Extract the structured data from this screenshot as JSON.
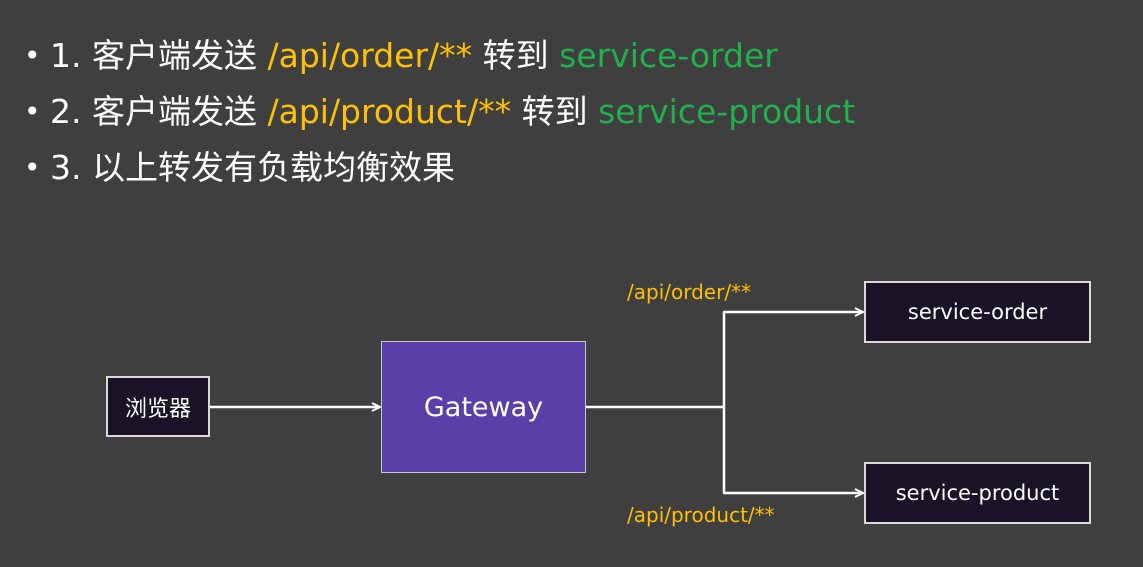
{
  "bullets": [
    {
      "num": "1. ",
      "text1": "客户端发送 ",
      "path": "/api/order/**",
      "text2": " 转到 ",
      "service": "service-order"
    },
    {
      "num": "2. ",
      "text1": "客户端发送 ",
      "path": "/api/product/**",
      "text2": " 转到 ",
      "service": "service-product"
    },
    {
      "num": "3. ",
      "text1": "以上转发有负载均衡效果"
    }
  ],
  "diagram": {
    "browser_label": "浏览器",
    "gateway_label": "Gateway",
    "order_service_label": "service-order",
    "product_service_label": "service-product",
    "order_route_label": "/api/order/**",
    "product_route_label": "/api/product/**"
  },
  "colors": {
    "background": "#3f3f3f",
    "path_highlight": "#ffc000",
    "service_highlight": "#21b14c",
    "gateway_fill": "#5b3fa8",
    "node_fill": "#1a1328",
    "connector": "#ffffff"
  }
}
